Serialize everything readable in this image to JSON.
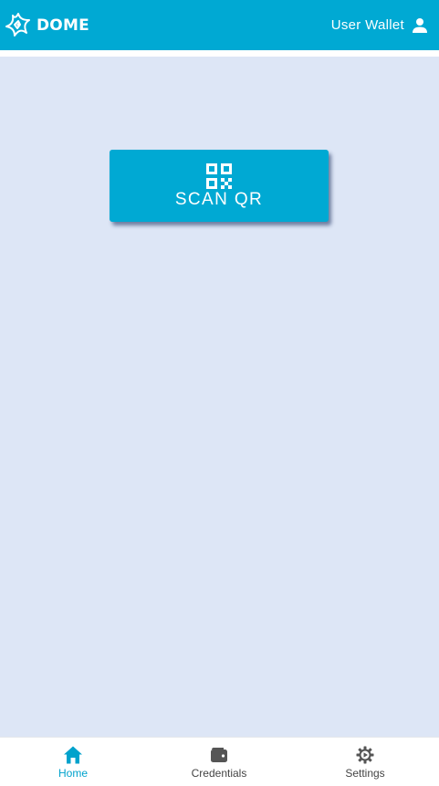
{
  "header": {
    "brand": "DOME",
    "user_label": "User Wallet",
    "logo_icon": "dome-logo-icon",
    "user_icon": "person-icon"
  },
  "main": {
    "scan_button": {
      "label": "SCAN QR",
      "icon": "qr-code-icon"
    }
  },
  "bottom_nav": {
    "items": [
      {
        "label": "Home",
        "icon": "home-icon",
        "active": true
      },
      {
        "label": "Credentials",
        "icon": "wallet-icon",
        "active": false
      },
      {
        "label": "Settings",
        "icon": "gear-icon",
        "active": false
      }
    ]
  },
  "colors": {
    "primary": "#00a9d3",
    "background": "#dde6f6",
    "active_nav": "#00a2cc",
    "inactive_nav": "#555555"
  }
}
